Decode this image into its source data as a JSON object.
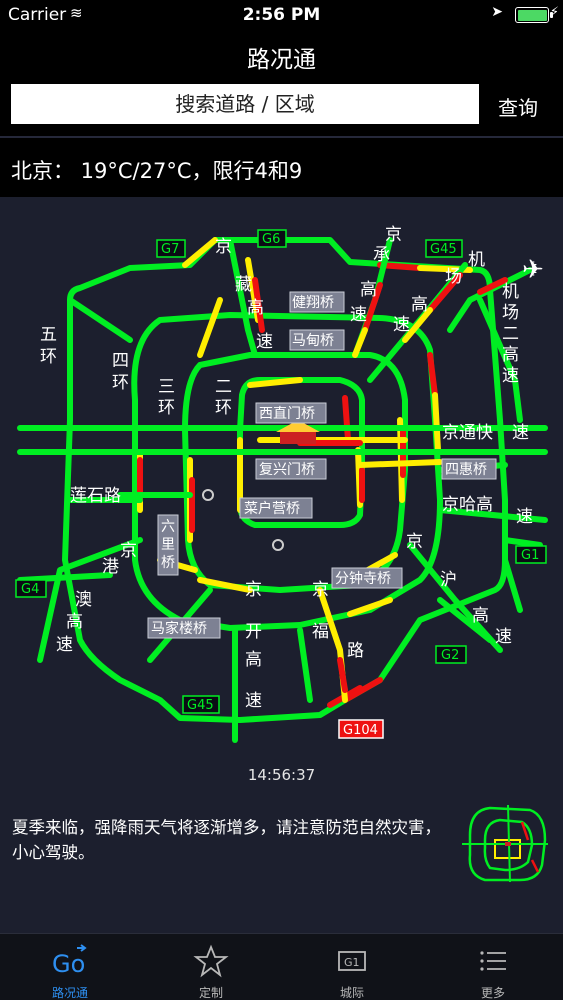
{
  "status_bar": {
    "carrier": "Carrier",
    "time": "2:56 PM"
  },
  "header": {
    "title": "路况通",
    "search_placeholder": "搜索道路 / 区域",
    "query_label": "查询"
  },
  "weather": {
    "text": "北京： 19°C/27°C，限行4和9"
  },
  "map": {
    "timestamp": "14:56:37",
    "road_codes": [
      "G7",
      "G6",
      "G45",
      "G4",
      "G1",
      "G2",
      "G45",
      "G104"
    ],
    "bridges": [
      "健翔桥",
      "马甸桥",
      "西直门桥",
      "复兴门桥",
      "菜户营桥",
      "六里桥",
      "马家楼桥",
      "分钟寺桥",
      "四惠桥"
    ],
    "road_labels": [
      "京",
      "藏",
      "高",
      "速",
      "京",
      "承",
      "高",
      "速",
      "高",
      "速",
      "机",
      "场",
      "机",
      "场",
      "二",
      "高",
      "速",
      "五",
      "环",
      "四",
      "环",
      "三",
      "环",
      "二",
      "环",
      "京通快",
      "速",
      "京哈高",
      "速",
      "莲石路",
      "京",
      "港",
      "澳",
      "高",
      "速",
      "京",
      "开",
      "高",
      "速",
      "京",
      "福",
      "路",
      "京",
      "沪",
      "高",
      "速"
    ],
    "colors": {
      "free": "#00ee22",
      "slow": "#ffee00",
      "jam": "#ee1111",
      "label_bg": "#7d8193",
      "background": "#1c1f2e"
    }
  },
  "notice": "夏季来临，强降雨天气将逐渐增多，请注意防范自然灾害，小心驾驶。",
  "tabs": [
    {
      "label": "路况通",
      "icon": "go-icon",
      "active": true
    },
    {
      "label": "定制",
      "icon": "star-icon",
      "active": false
    },
    {
      "label": "城际",
      "icon": "g1-icon",
      "active": false
    },
    {
      "label": "更多",
      "icon": "list-icon",
      "active": false
    }
  ]
}
